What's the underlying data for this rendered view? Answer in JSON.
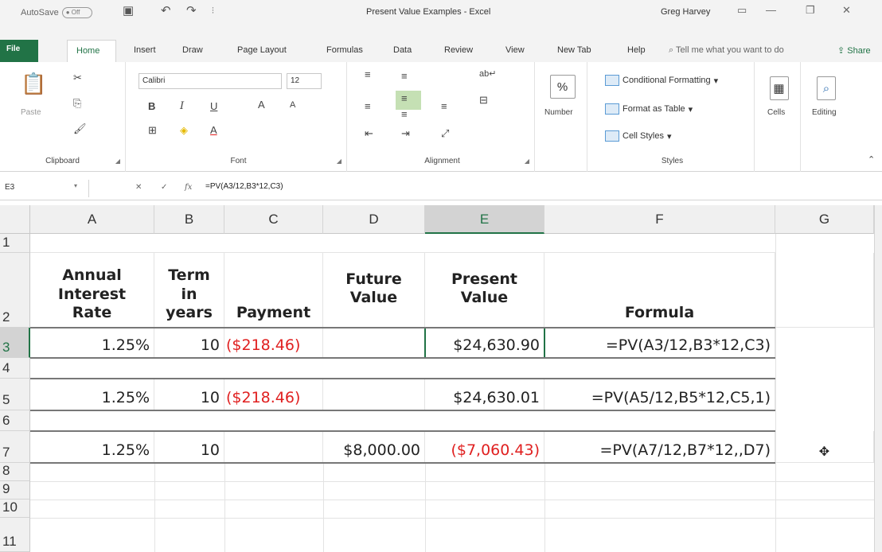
{
  "titlebar": {
    "autosave_label": "AutoSave",
    "autosave_state": "Off",
    "document_title": "Present Value Examples  -  Excel",
    "user": "Greg Harvey"
  },
  "tabs": [
    "File",
    "Home",
    "Insert",
    "Draw",
    "Page Layout",
    "Formulas",
    "Data",
    "Review",
    "View",
    "New Tab",
    "Help"
  ],
  "tell_me": "Tell me what you want to do",
  "share_label": "Share",
  "ribbon": {
    "clipboard": {
      "label": "Clipboard",
      "paste": "Paste"
    },
    "font": {
      "label": "Font",
      "name": "Calibri",
      "size": "12",
      "bold": "B",
      "italic": "I",
      "underline": "U"
    },
    "alignment": {
      "label": "Alignment"
    },
    "number": {
      "label": "Number",
      "format": "%"
    },
    "styles": {
      "label": "Styles",
      "items": [
        "Conditional Formatting",
        "Format as Table",
        "Cell Styles"
      ]
    },
    "cells": {
      "label": "Cells"
    },
    "editing": {
      "label": "Editing"
    }
  },
  "formula_bar": {
    "name_box": "E3",
    "fx": "fx",
    "formula": "=PV(A3/12,B3*12,C3)"
  },
  "sheet": {
    "columns": [
      "A",
      "B",
      "C",
      "D",
      "E",
      "F",
      "G"
    ],
    "selected_column": "E",
    "selected_row": "3",
    "rows": [
      "1",
      "2",
      "3",
      "4",
      "5",
      "6",
      "7",
      "8",
      "9",
      "10",
      "11"
    ],
    "headers": {
      "a": [
        "Annual",
        "Interest",
        "Rate"
      ],
      "b": [
        "Term",
        "in",
        "years"
      ],
      "c": [
        "Payment"
      ],
      "d": [
        "Future",
        "Value"
      ],
      "e": [
        "Present",
        "Value"
      ],
      "f": [
        "Formula"
      ]
    },
    "row3": {
      "a": "1.25%",
      "b": "10",
      "c": "($218.46)",
      "d": "",
      "e": "$24,630.90",
      "f": "=PV(A3/12,B3*12,C3)"
    },
    "row5": {
      "a": "1.25%",
      "b": "10",
      "c": "($218.46)",
      "d": "",
      "e": "$24,630.01",
      "f": "=PV(A5/12,B5*12,C5,1)"
    },
    "row7": {
      "a": "1.25%",
      "b": "10",
      "c": "",
      "d": "$8,000.00",
      "e": "($7,060.43)",
      "f": "=PV(A7/12,B7*12,,D7)"
    }
  },
  "colors": {
    "excel_green": "#217346",
    "negative": "#e02020",
    "selection_fill": "#c5e0b4"
  }
}
